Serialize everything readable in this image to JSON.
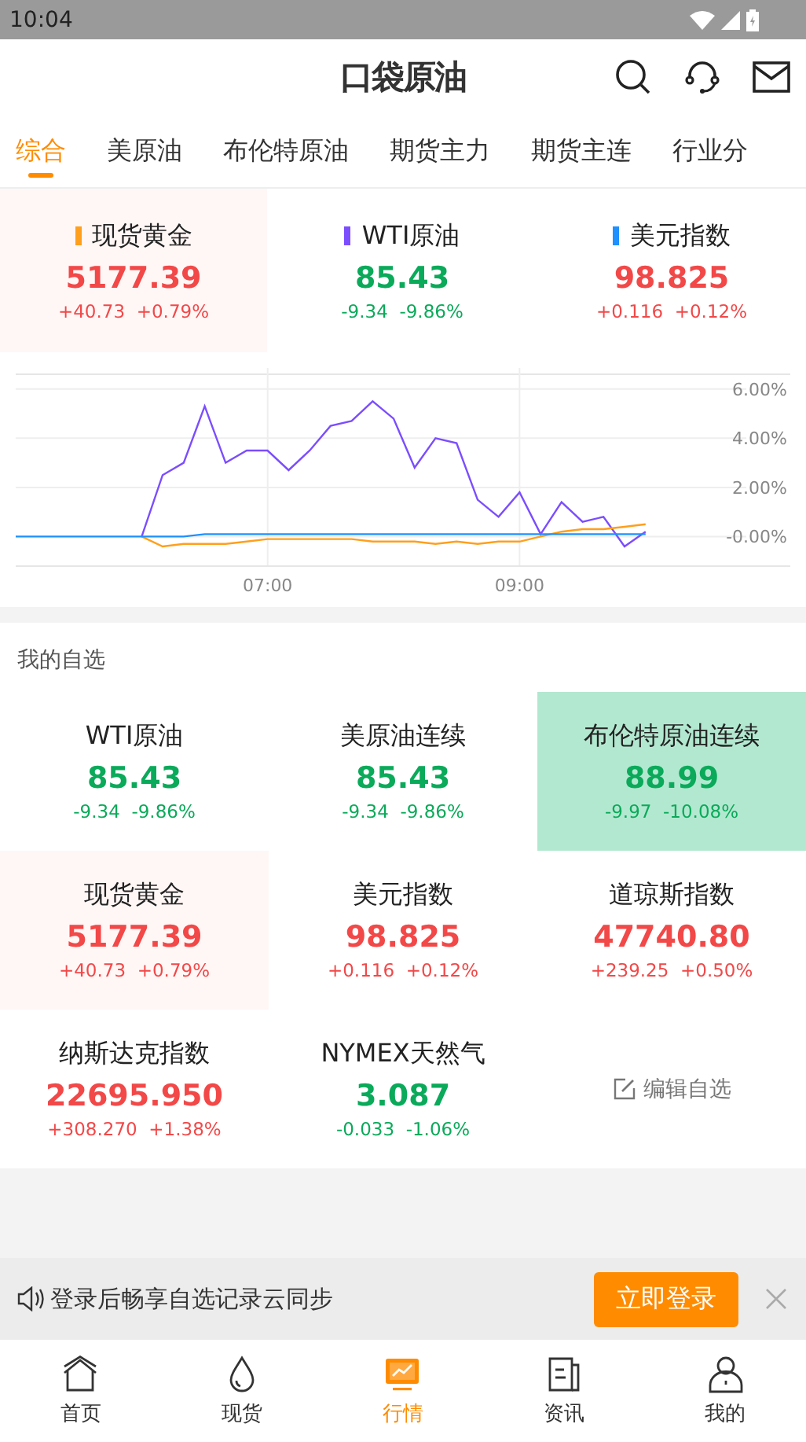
{
  "status_bar": {
    "time": "10:04"
  },
  "header": {
    "logo": "口袋原油"
  },
  "tabs": [
    {
      "label": "综合",
      "selected": true
    },
    {
      "label": "美原油",
      "selected": false
    },
    {
      "label": "布伦特原油",
      "selected": false
    },
    {
      "label": "期货主力",
      "selected": false
    },
    {
      "label": "期货主连",
      "selected": false
    },
    {
      "label": "行业分",
      "selected": false
    }
  ],
  "index_cards": [
    {
      "name": "现货黄金",
      "color": "#ff9f1c",
      "price": "5177.39",
      "change": "+40.73",
      "percent": "+0.79%",
      "rising": true,
      "highlighted": true
    },
    {
      "name": "WTI原油",
      "color": "#7b4dff",
      "price": "85.43",
      "change": "-9.34",
      "percent": "-9.86%",
      "rising": false,
      "highlighted": false
    },
    {
      "name": "美元指数",
      "color": "#1e90ff",
      "price": "98.825",
      "change": "+0.116",
      "percent": "+0.12%",
      "rising": true,
      "highlighted": false
    }
  ],
  "chart": {
    "chart_data": {
      "type": "line",
      "grid": true,
      "categories": [
        null,
        null,
        null,
        null,
        null,
        null,
        null,
        null,
        null,
        null,
        null,
        null,
        "07:00",
        null,
        null,
        null,
        null,
        null,
        null,
        null,
        null,
        null,
        null,
        null,
        "09:00",
        null,
        null,
        null,
        null,
        null,
        null
      ],
      "ylim": [
        -1.2,
        6.6
      ],
      "yticks": [
        {
          "value": 6,
          "label": "6.00%"
        },
        {
          "value": 4,
          "label": "4.00%"
        },
        {
          "value": 2,
          "label": "2.00%"
        },
        {
          "value": 0,
          "label": "-0.00%"
        }
      ],
      "series": [
        {
          "color": "#7b4dff",
          "values": [
            null,
            null,
            null,
            null,
            null,
            null,
            0,
            2.5,
            3.0,
            5.3,
            3.0,
            3.5,
            3.5,
            2.7,
            3.5,
            4.5,
            4.7,
            5.5,
            4.8,
            2.8,
            4.0,
            3.8,
            1.5,
            0.8,
            1.8,
            0.1,
            1.4,
            0.6,
            0.8,
            -0.4,
            0.2
          ]
        },
        {
          "color": "#ff9f1c",
          "values": [
            null,
            null,
            null,
            null,
            null,
            null,
            0,
            -0.4,
            -0.3,
            -0.3,
            -0.3,
            -0.2,
            -0.1,
            -0.1,
            -0.1,
            -0.1,
            -0.1,
            -0.2,
            -0.2,
            -0.2,
            -0.3,
            -0.2,
            -0.3,
            -0.2,
            -0.2,
            0.0,
            0.2,
            0.3,
            0.3,
            0.4,
            0.5
          ]
        },
        {
          "color": "#1e90ff",
          "values": [
            0,
            0,
            0,
            0,
            0,
            0,
            0,
            0,
            0,
            0.1,
            0.1,
            0.1,
            0.1,
            0.1,
            0.1,
            0.1,
            0.1,
            0.1,
            0.1,
            0.1,
            0.1,
            0.1,
            0.1,
            0.1,
            0.1,
            0.1,
            0.1,
            0.1,
            0.1,
            0.1,
            0.1
          ]
        }
      ]
    }
  },
  "watchlist": {
    "title": "我的自选",
    "items": [
      {
        "name": "WTI原油",
        "price": "85.43",
        "change": "-9.34",
        "percent": "-9.86%",
        "rising": false,
        "highlighted": false
      },
      {
        "name": "美原油连续",
        "price": "85.43",
        "change": "-9.34",
        "percent": "-9.86%",
        "rising": false,
        "highlighted": false
      },
      {
        "name": "布伦特原油连续",
        "price": "88.99",
        "change": "-9.97",
        "percent": "-10.08%",
        "rising": false,
        "highlighted": true
      },
      {
        "name": "现货黄金",
        "price": "5177.39",
        "change": "+40.73",
        "percent": "+0.79%",
        "rising": true,
        "highlighted": true
      },
      {
        "name": "美元指数",
        "price": "98.825",
        "change": "+0.116",
        "percent": "+0.12%",
        "rising": true,
        "highlighted": false
      },
      {
        "name": "道琼斯指数",
        "price": "47740.80",
        "change": "+239.25",
        "percent": "+0.50%",
        "rising": true,
        "highlighted": false
      },
      {
        "name": "纳斯达克指数",
        "price": "22695.950",
        "change": "+308.270",
        "percent": "+1.38%",
        "rising": true,
        "highlighted": false
      },
      {
        "name": "NYMEX天然气",
        "price": "3.087",
        "change": "-0.033",
        "percent": "-1.06%",
        "rising": false,
        "highlighted": false
      }
    ],
    "edit_label": "编辑自选"
  },
  "login_banner": {
    "message": "登录后畅享自选记录云同步",
    "button": "立即登录"
  },
  "bottom_nav": [
    {
      "label": "首页",
      "selected": false
    },
    {
      "label": "现货",
      "selected": false
    },
    {
      "label": "行情",
      "selected": true
    },
    {
      "label": "资讯",
      "selected": false
    },
    {
      "label": "我的",
      "selected": false
    }
  ]
}
